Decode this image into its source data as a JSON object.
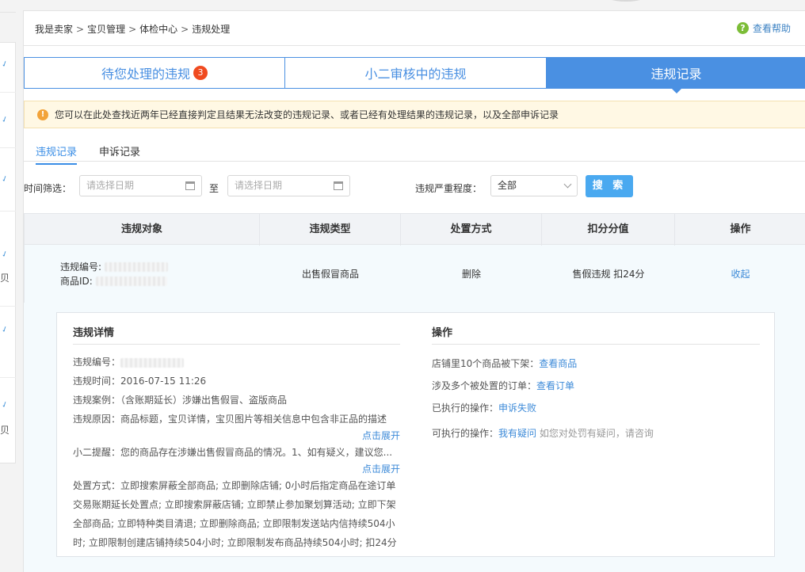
{
  "breadcrumb": [
    "我是卖家",
    "宝贝管理",
    "体检中心",
    "违规处理"
  ],
  "breadcrumb_sep": ">",
  "help": {
    "label": "查看帮助"
  },
  "tabs": [
    {
      "label": "待您处理的违规",
      "badge": "3"
    },
    {
      "label": "小二审核中的违规"
    },
    {
      "label": "违规记录"
    }
  ],
  "notice": "您可以在此处查找近两年已经直接判定且结果无法改变的违规记录、或者已经有处理结果的违规记录，以及全部申诉记录",
  "subtabs": [
    {
      "label": "违规记录"
    },
    {
      "label": "申诉记录"
    }
  ],
  "filter": {
    "time_label": "时间筛选：",
    "start_placeholder": "请选择日期",
    "to": "至",
    "end_placeholder": "请选择日期",
    "severity_label": "违规严重程度：",
    "severity_value": "全部",
    "search_label": "搜 索"
  },
  "table": {
    "headers": [
      "违规对象",
      "违规类型",
      "处置方式",
      "扣分分值",
      "操作"
    ],
    "row": {
      "id_label": "违规编号:",
      "item_label": "商品ID:",
      "type": "出售假冒商品",
      "method": "删除",
      "points": "售假违规 扣24分",
      "action": "收起"
    }
  },
  "detail": {
    "left_title": "违规详情",
    "id_label": "违规编号：",
    "time_label": "违规时间：",
    "time_value": "2016-07-15 11:26",
    "case_label": "违规案例：",
    "case_value": "（含账期延长）涉嫌出售假冒、盗版商品",
    "reason_label": "违规原因：",
    "reason_value": "商品标题，宝贝详情，宝贝图片等相关信息中包含非正品的描述",
    "expand1": "点击展开",
    "tip_label": "小二提醒：",
    "tip_value": "您的商品存在涉嫌出售假冒商品的情况。1、如有疑义，建议您...",
    "expand2": "点击展开",
    "method_label": "处置方式：",
    "method_value": "立即搜索屏蔽全部商品; 立即删除店铺; 0小时后指定商品在途订单交易账期延长处置点; 立即搜索屏蔽店铺; 立即禁止参加聚划算活动; 立即下架全部商品; 立即特种类目清退; 立即删除商品; 立即限制发送站内信持续504小时; 立即限制创建店铺持续504小时; 立即限制发布商品持续504小时; 扣24分",
    "right_title": "操作",
    "r1_label": "店铺里10个商品被下架：",
    "r1_link": "查看商品",
    "r2_label": "涉及多个被处置的订单：",
    "r2_link": "查看订单",
    "r3_label": "已执行的操作：",
    "r3_link": "申诉失败",
    "r4_label": "可执行的操作：",
    "r4_link": "我有疑问",
    "r4_note": "如您对处罚有疑问，请咨询"
  },
  "left_fragments": [
    "贝",
    "宝贝"
  ],
  "colors": {
    "accent": "#4a90e2",
    "badge": "#f04a1f",
    "link": "#3c8ad8",
    "notice_bg": "#fff8e4"
  }
}
